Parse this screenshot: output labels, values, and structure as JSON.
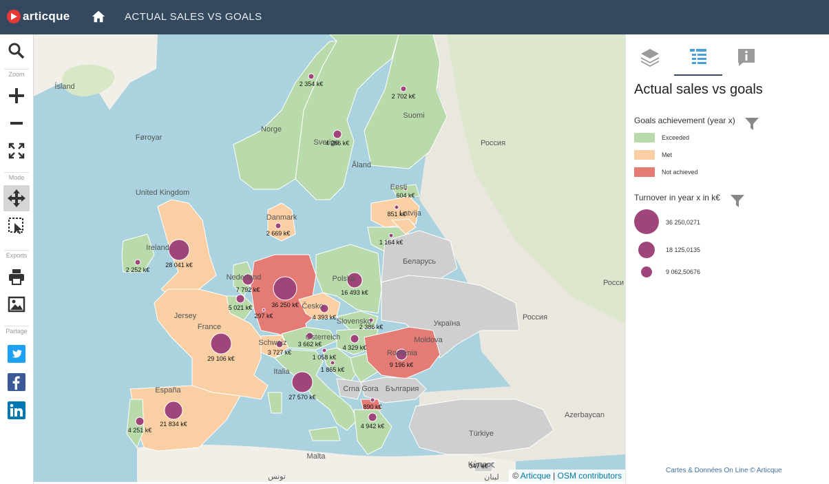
{
  "app": {
    "brand": "articque",
    "title": "ACTUAL SALES VS GOALS"
  },
  "toolbar": {
    "zoom_label": "Zoom",
    "mode_label": "Mode",
    "exports_label": "Exports",
    "share_label": "Partage"
  },
  "panel": {
    "title": "Actual sales vs goals",
    "goals_legend": {
      "title": "Goals achievement (year x)",
      "items": [
        {
          "label": "Exceeded",
          "color": "#b9dbab"
        },
        {
          "label": "Met",
          "color": "#f9cfa3"
        },
        {
          "label": "Not achieved",
          "color": "#e47b74"
        }
      ]
    },
    "turnover_legend": {
      "title": "Turnover in year x in k€",
      "items": [
        {
          "label": "36 250,0271"
        },
        {
          "label": "18 125,0135"
        },
        {
          "label": "9 062,50676"
        }
      ]
    },
    "credits": "Cartes & Données On Line © Articque"
  },
  "map": {
    "attribution": {
      "prefix": "©",
      "articque": "Articque",
      "sep": "|",
      "osm": "OSM contributors"
    },
    "bubble_color": "#a0457a",
    "bubbles": [
      {
        "label": "2 354 k€"
      },
      {
        "label": "2 702 k€"
      },
      {
        "label": "4 266 k€"
      },
      {
        "label": "604 k€"
      },
      {
        "label": "851 k€"
      },
      {
        "label": "1 164 k€"
      },
      {
        "label": "2 669 k€"
      },
      {
        "label": "2 252 k€"
      },
      {
        "label": "28 041 k€"
      },
      {
        "label": "7 792 k€"
      },
      {
        "label": "5 021 k€"
      },
      {
        "label": "297 k€"
      },
      {
        "label": "36 250 k€"
      },
      {
        "label": "16 493 k€"
      },
      {
        "label": "4 393 k€"
      },
      {
        "label": "2 386 k€"
      },
      {
        "label": "4 329 k€"
      },
      {
        "label": "3 662 k€"
      },
      {
        "label": "3 727 k€"
      },
      {
        "label": "29 106 k€"
      },
      {
        "label": "1 058 k€"
      },
      {
        "label": "1 865 k€"
      },
      {
        "label": "9 196 k€"
      },
      {
        "label": "27 570 k€"
      },
      {
        "label": "890 k€"
      },
      {
        "label": "4 942 k€"
      },
      {
        "label": "4 251 k€"
      },
      {
        "label": "21 834 k€"
      },
      {
        "label": "347 k€"
      }
    ],
    "place_labels": [
      "Ísland",
      "Føroyar",
      "United Kingdom",
      "Norge",
      "Sverige",
      "Suomi",
      "Россия",
      "Россия",
      "Росси",
      "Åland",
      "Беларусь",
      "Україна",
      "Moldova",
      "România",
      "Danmark",
      "Eesti",
      "Latvija",
      "Nederland",
      "Polska",
      "Česko",
      "Slovensko",
      "Österreich",
      "Schweiz",
      "Jersey",
      "France",
      "Italia",
      "España",
      "Crna Gora",
      "България",
      "Türkiye",
      "Azerbaycan",
      "Malta",
      "تونس",
      "لبنان",
      "Κύπρος",
      "Ireland"
    ]
  }
}
